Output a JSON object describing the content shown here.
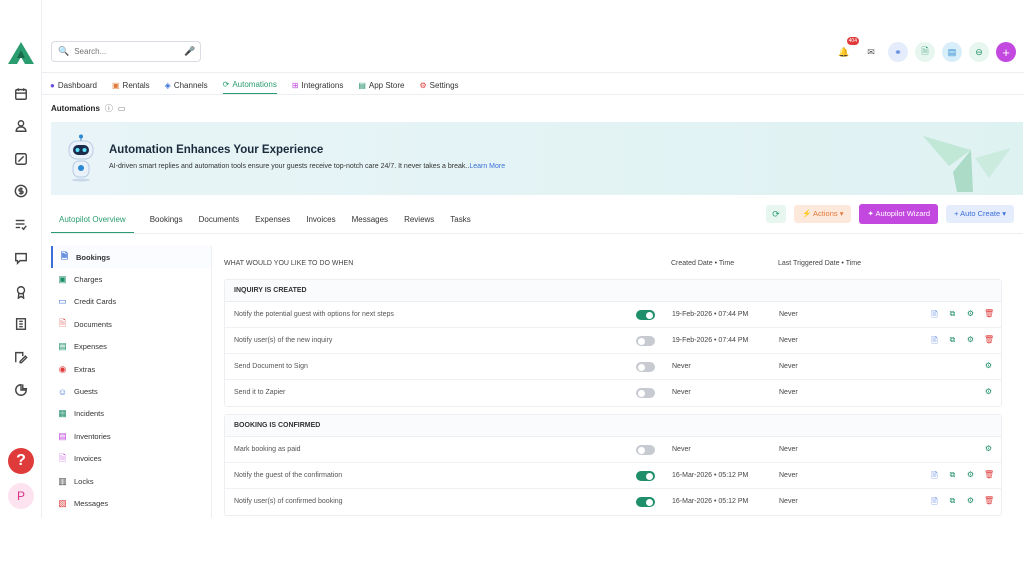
{
  "search": {
    "placeholder": "Search..."
  },
  "topbar": {
    "notification_count": "404"
  },
  "nav": {
    "tabs": [
      {
        "label": "Dashboard",
        "icon": "globe-icon"
      },
      {
        "label": "Rentals",
        "icon": "building-icon"
      },
      {
        "label": "Channels",
        "icon": "layers-icon"
      },
      {
        "label": "Automations",
        "icon": "sync-icon",
        "active": true
      },
      {
        "label": "Integrations",
        "icon": "grid-icon"
      },
      {
        "label": "App Store",
        "icon": "store-icon"
      },
      {
        "label": "Settings",
        "icon": "gear-icon"
      }
    ]
  },
  "page": {
    "title": "Automations"
  },
  "banner": {
    "title": "Automation Enhances Your Experience",
    "text": "AI-driven smart replies and automation tools ensure your guests receive top-notch care 24/7. It never takes a break..",
    "link": "Learn More"
  },
  "subtabs": [
    "Autopilot Overview",
    "Bookings",
    "Documents",
    "Expenses",
    "Invoices",
    "Messages",
    "Reviews",
    "Tasks"
  ],
  "actions": {
    "actions_label": "Actions",
    "wizard_label": "Autopilot Wizard",
    "auto_create_label": "+ Auto Create"
  },
  "categories": [
    "Bookings",
    "Charges",
    "Credit Cards",
    "Documents",
    "Expenses",
    "Extras",
    "Guests",
    "Incidents",
    "Inventories",
    "Invoices",
    "Locks",
    "Messages"
  ],
  "table": {
    "col_when": "WHAT WOULD YOU LIKE TO DO WHEN",
    "col_created": "Created Date • Time",
    "col_last": "Last Triggered Date • Time",
    "sections": [
      {
        "title": "INQUIRY IS CREATED",
        "rows": [
          {
            "label": "Notify the potential guest with options for next steps",
            "on": true,
            "created": "19-Feb-2026 • 07:44 PM",
            "last": "Never",
            "full": true
          },
          {
            "label": "Notify user(s) of the new inquiry",
            "on": false,
            "created": "19-Feb-2026 • 07:44 PM",
            "last": "Never",
            "full": true
          },
          {
            "label": "Send Document to Sign",
            "on": false,
            "created": "Never",
            "last": "Never",
            "full": false
          },
          {
            "label": "Send it to Zapier",
            "on": false,
            "created": "Never",
            "last": "Never",
            "full": false
          }
        ]
      },
      {
        "title": "BOOKING IS CONFIRMED",
        "rows": [
          {
            "label": "Mark booking as paid",
            "on": false,
            "created": "Never",
            "last": "Never",
            "full": false
          },
          {
            "label": "Notify the guest of the confirmation",
            "on": true,
            "created": "16-Mar-2026 • 05:12 PM",
            "last": "Never",
            "full": true
          },
          {
            "label": "Notify user(s) of confirmed booking",
            "on": true,
            "created": "16-Mar-2026 • 05:12 PM",
            "last": "Never",
            "full": true
          }
        ]
      }
    ]
  },
  "colors": {
    "accent": "#2a9d6f",
    "wizard": "#c348e0",
    "blue": "#3b6fd8",
    "danger": "#e03b3b"
  }
}
